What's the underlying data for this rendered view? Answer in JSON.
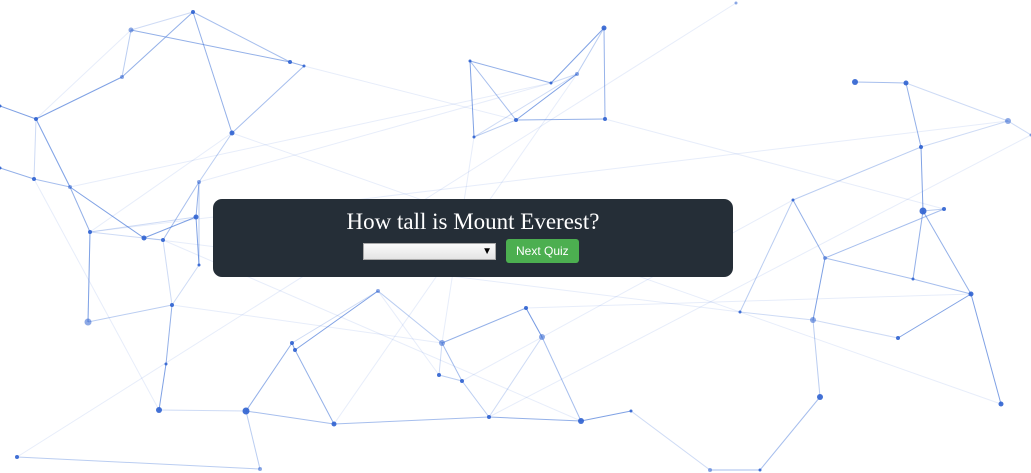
{
  "quiz": {
    "question": "How tall is Mount Everest?",
    "answer_selected": "",
    "next_label": "Next Quiz"
  },
  "background": {
    "pattern": "particle-network",
    "line_color": "#3a6fd6",
    "node_color": "#2f62d0"
  },
  "colors": {
    "panel": "#252e37",
    "button": "#4caf50",
    "question_text": "#ffffff"
  }
}
